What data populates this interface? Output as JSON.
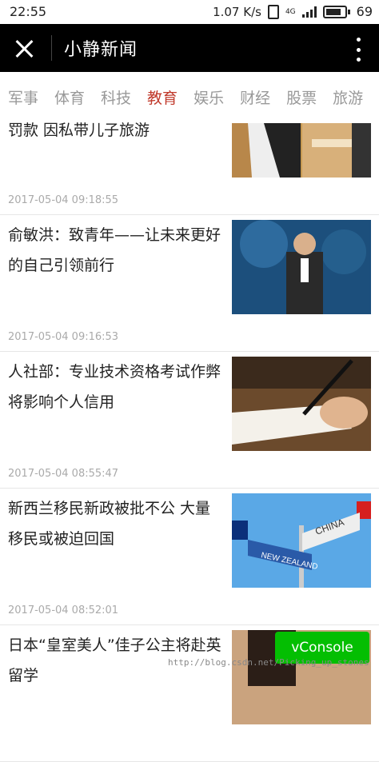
{
  "statusbar": {
    "time": "22:55",
    "speed": "1.07 K/s",
    "network": "4G",
    "battery": "69"
  },
  "appbar": {
    "title": "小静新闻"
  },
  "tabs": [
    {
      "label": "军事"
    },
    {
      "label": "体育"
    },
    {
      "label": "科技"
    },
    {
      "label": "教育",
      "active": true
    },
    {
      "label": "娱乐"
    },
    {
      "label": "财经"
    },
    {
      "label": "股票"
    },
    {
      "label": "旅游"
    }
  ],
  "news": [
    {
      "title": "罚款 因私带儿子旅游",
      "date": "2017-05-04 09:18:55"
    },
    {
      "title": "俞敏洪：致青年——让未来更好的自己引领前行",
      "date": "2017-05-04 09:16:53"
    },
    {
      "title": "人社部：专业技术资格考试作弊将影响个人信用",
      "date": "2017-05-04 08:55:47"
    },
    {
      "title": "新西兰移民新政被批不公 大量移民或被迫回国",
      "date": "2017-05-04 08:52:01"
    },
    {
      "title": "日本“皇室美人”佳子公主将赴英留学",
      "date": ""
    }
  ],
  "images": {
    "sign_new_zealand": "NEW ZEALAND",
    "sign_china": "CHINA"
  },
  "vconsole": {
    "label": "vConsole"
  },
  "watermark": "http://blog.csdn.net/Picking_up_stones",
  "colors": {
    "accent": "#c0392b",
    "appbar": "#000000",
    "vconsole": "#04be02"
  }
}
